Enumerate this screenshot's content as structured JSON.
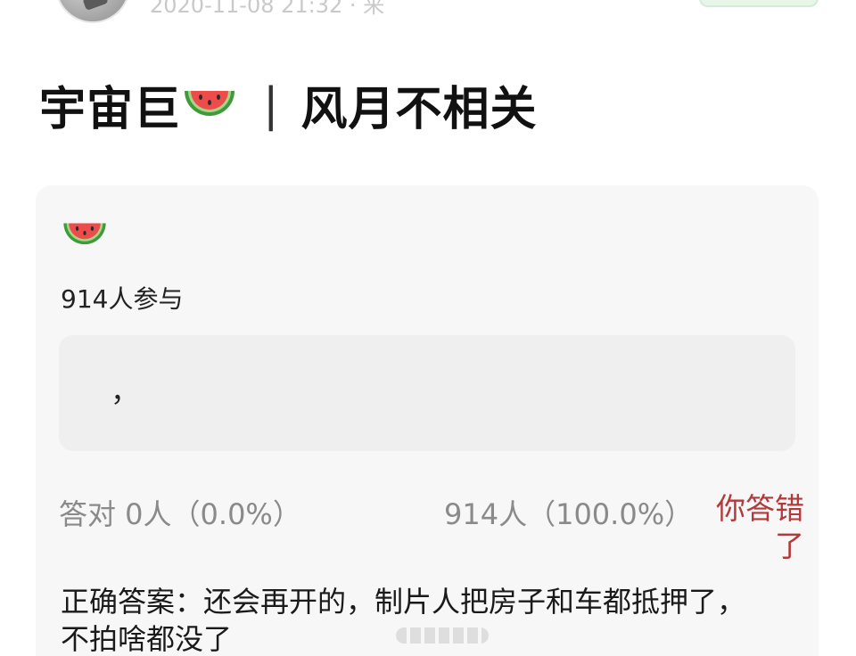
{
  "header": {
    "meta_text": "2020-11-08 21:32 · 来",
    "follow_label": ""
  },
  "post": {
    "title_left": "宇宙巨",
    "title_separator": "|",
    "title_right": "风月不相关"
  },
  "quiz": {
    "participants": "914人参与",
    "option_text": "，",
    "correct_stat": "答对  0人（0.0%）",
    "wrong_stat": "914人（100.0%）",
    "result_label": "你答错了",
    "answer": "正确答案：还会再开的，制片人把房子和车都抵押了，不拍啥都没了"
  },
  "icons": {
    "title_icon": "watermelon-icon",
    "card_icon": "watermelon-icon"
  },
  "colors": {
    "wrong_accent": "#b23a3a",
    "muted_text": "#8a8a8a",
    "card_bg": "#f7f7f7"
  }
}
